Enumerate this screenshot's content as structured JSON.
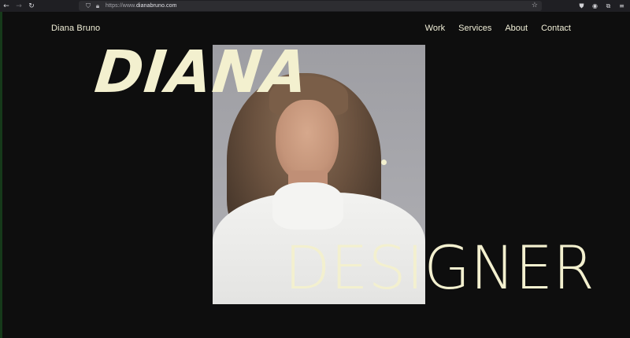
{
  "browser": {
    "url_scheme": "https://www.",
    "url_host": "dianabruno.com",
    "icons": {
      "back": "arrow-left-icon",
      "forward": "arrow-right-icon",
      "reload": "reload-icon",
      "shield": "shield-icon",
      "lock": "lock-icon",
      "bookmark": "star-icon",
      "pocket": "pocket-icon",
      "account": "account-icon",
      "extensions": "puzzle-icon",
      "menu": "hamburger-icon"
    }
  },
  "site": {
    "brand": "Diana Bruno",
    "nav": [
      "Work",
      "Services",
      "About",
      "Contact"
    ],
    "hero_top": "DIANA",
    "hero_bottom": "DESIGNER"
  },
  "colors": {
    "background": "#0e0e0e",
    "accent_text": "#f3f0cf",
    "nav_text": "#f1efd8"
  }
}
